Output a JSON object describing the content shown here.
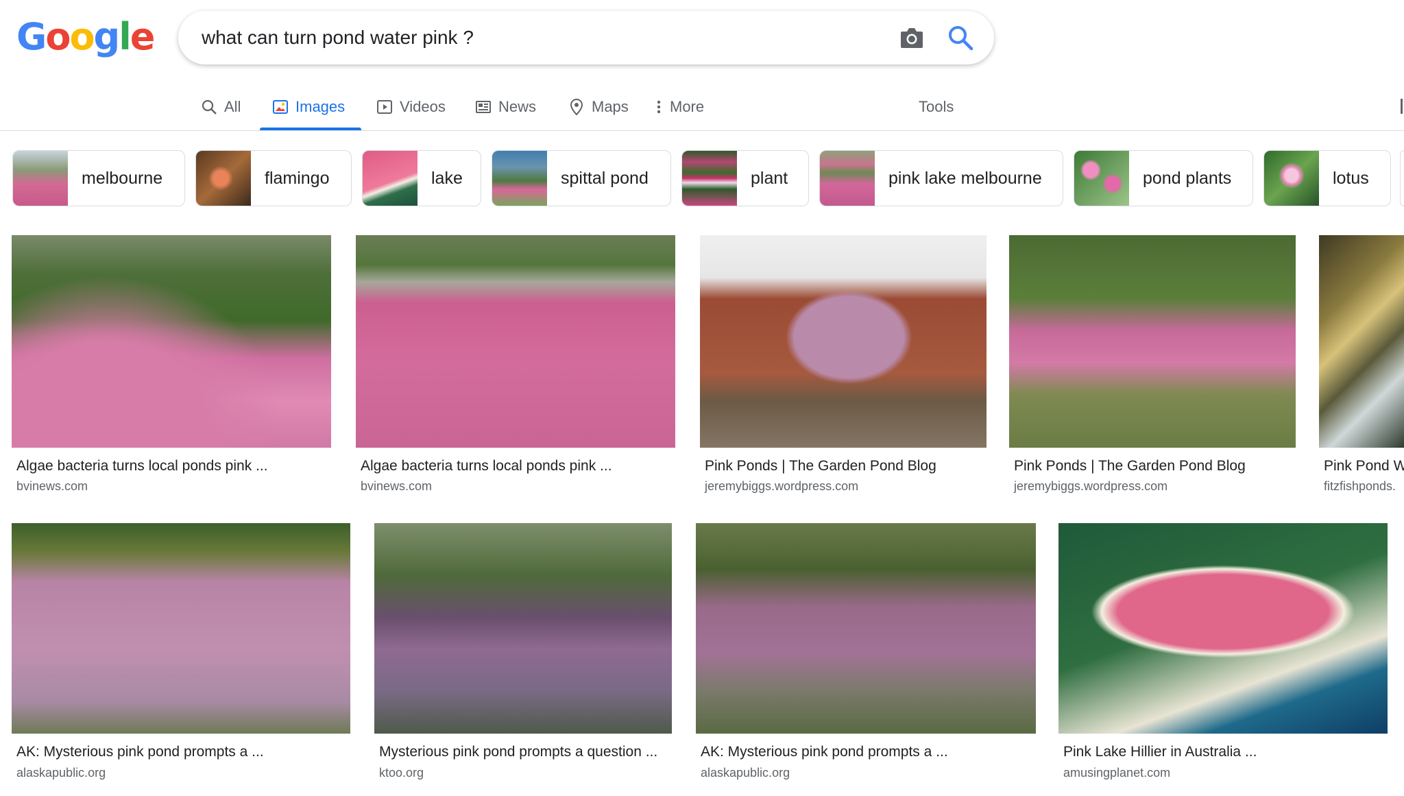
{
  "logo": {
    "letters": [
      "G",
      "o",
      "o",
      "g",
      "l",
      "e"
    ],
    "colors": [
      "#4285f4",
      "#ea4335",
      "#fbbc05",
      "#4285f4",
      "#34a853",
      "#ea4335"
    ]
  },
  "search": {
    "query": "what can turn pond water pink ?",
    "camera_icon": "camera-icon",
    "search_icon": "search-icon"
  },
  "tabs": [
    {
      "label": "All",
      "icon": "search-icon"
    },
    {
      "label": "Images",
      "icon": "image-icon",
      "active": true
    },
    {
      "label": "Videos",
      "icon": "play-icon"
    },
    {
      "label": "News",
      "icon": "newspaper-icon"
    },
    {
      "label": "Maps",
      "icon": "map-pin-icon"
    },
    {
      "label": "More",
      "icon": "more-vert-icon"
    }
  ],
  "tools_label": "Tools",
  "accent": "#1a73e8",
  "chips": [
    {
      "label": "melbourne"
    },
    {
      "label": "flamingo"
    },
    {
      "label": "lake"
    },
    {
      "label": "spittal pond"
    },
    {
      "label": "plant"
    },
    {
      "label": "pink lake melbourne"
    },
    {
      "label": "pond plants"
    },
    {
      "label": "lotus"
    }
  ],
  "results": [
    {
      "title": "Algae bacteria turns local ponds pink ...",
      "site": "bvinews.com"
    },
    {
      "title": "Algae bacteria turns local ponds pink ...",
      "site": "bvinews.com"
    },
    {
      "title": "Pink Ponds | The Garden Pond Blog",
      "site": "jeremybiggs.wordpress.com"
    },
    {
      "title": "Pink Ponds | The Garden Pond Blog",
      "site": "jeremybiggs.wordpress.com"
    },
    {
      "title": "Pink Pond W",
      "site": "fitzfishponds."
    },
    {
      "title": "AK: Mysterious pink pond prompts a ...",
      "site": "alaskapublic.org"
    },
    {
      "title": "Mysterious pink pond prompts a question ...",
      "site": "ktoo.org"
    },
    {
      "title": "AK: Mysterious pink pond prompts a ...",
      "site": "alaskapublic.org"
    },
    {
      "title": "Pink Lake Hillier in Australia ...",
      "site": "amusingplanet.com"
    }
  ]
}
